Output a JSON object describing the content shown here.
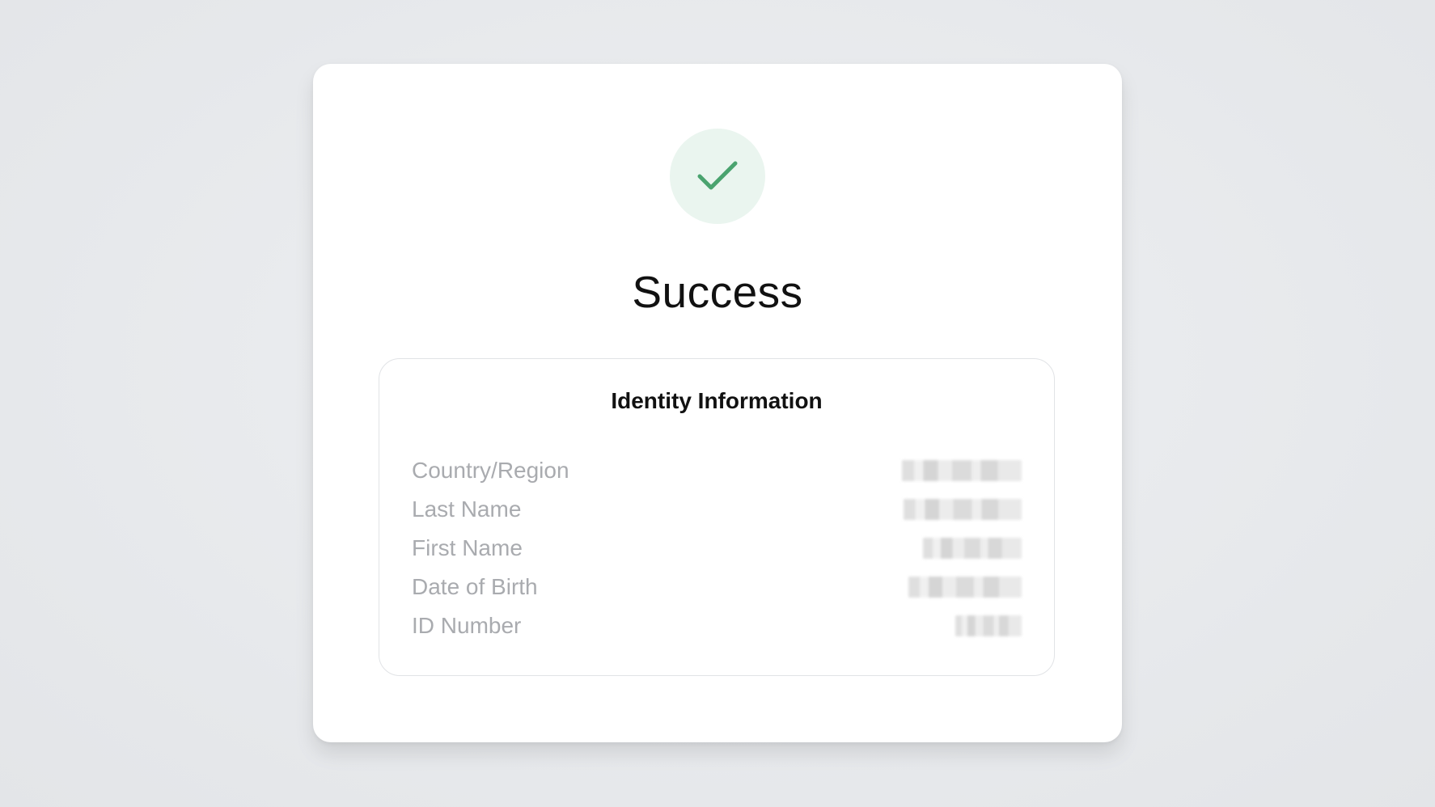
{
  "status": {
    "icon": "checkmark-icon",
    "accent_color": "#4aa36f",
    "circle_color": "#eaf5ef",
    "title": "Success"
  },
  "identity": {
    "heading": "Identity Information",
    "fields": [
      {
        "label": "Country/Region"
      },
      {
        "label": "Last Name"
      },
      {
        "label": "First Name"
      },
      {
        "label": "Date of Birth"
      },
      {
        "label": "ID Number"
      }
    ]
  }
}
